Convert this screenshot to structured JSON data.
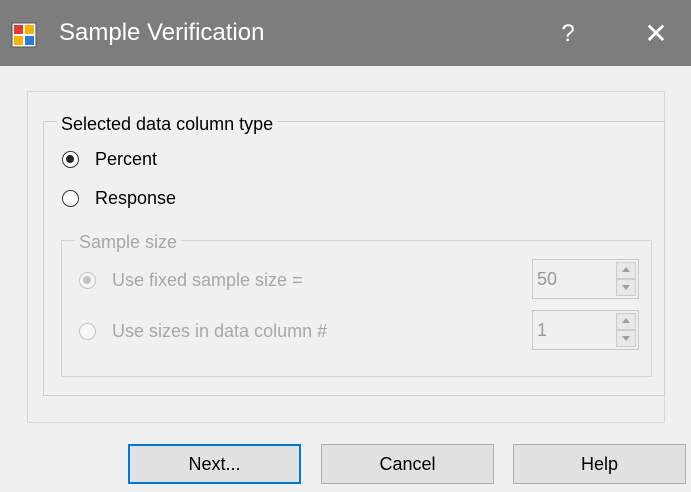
{
  "window": {
    "title": "Sample Verification",
    "help_glyph": "?",
    "close_glyph": "✕",
    "icon": "app-icon"
  },
  "column_type": {
    "legend": "Selected data column type",
    "options": [
      {
        "label": "Percent",
        "checked": true
      },
      {
        "label": "Response",
        "checked": false
      }
    ]
  },
  "sample_size": {
    "legend": "Sample size",
    "fixed": {
      "label": "Use fixed sample size =",
      "checked": true,
      "value": "50"
    },
    "column": {
      "label": "Use sizes in data column #",
      "checked": false,
      "value": "1"
    }
  },
  "buttons": {
    "next": "Next...",
    "cancel": "Cancel",
    "help": "Help"
  },
  "colors": {
    "titlebar": "#7d7d7d",
    "focus": "#0078d7"
  }
}
